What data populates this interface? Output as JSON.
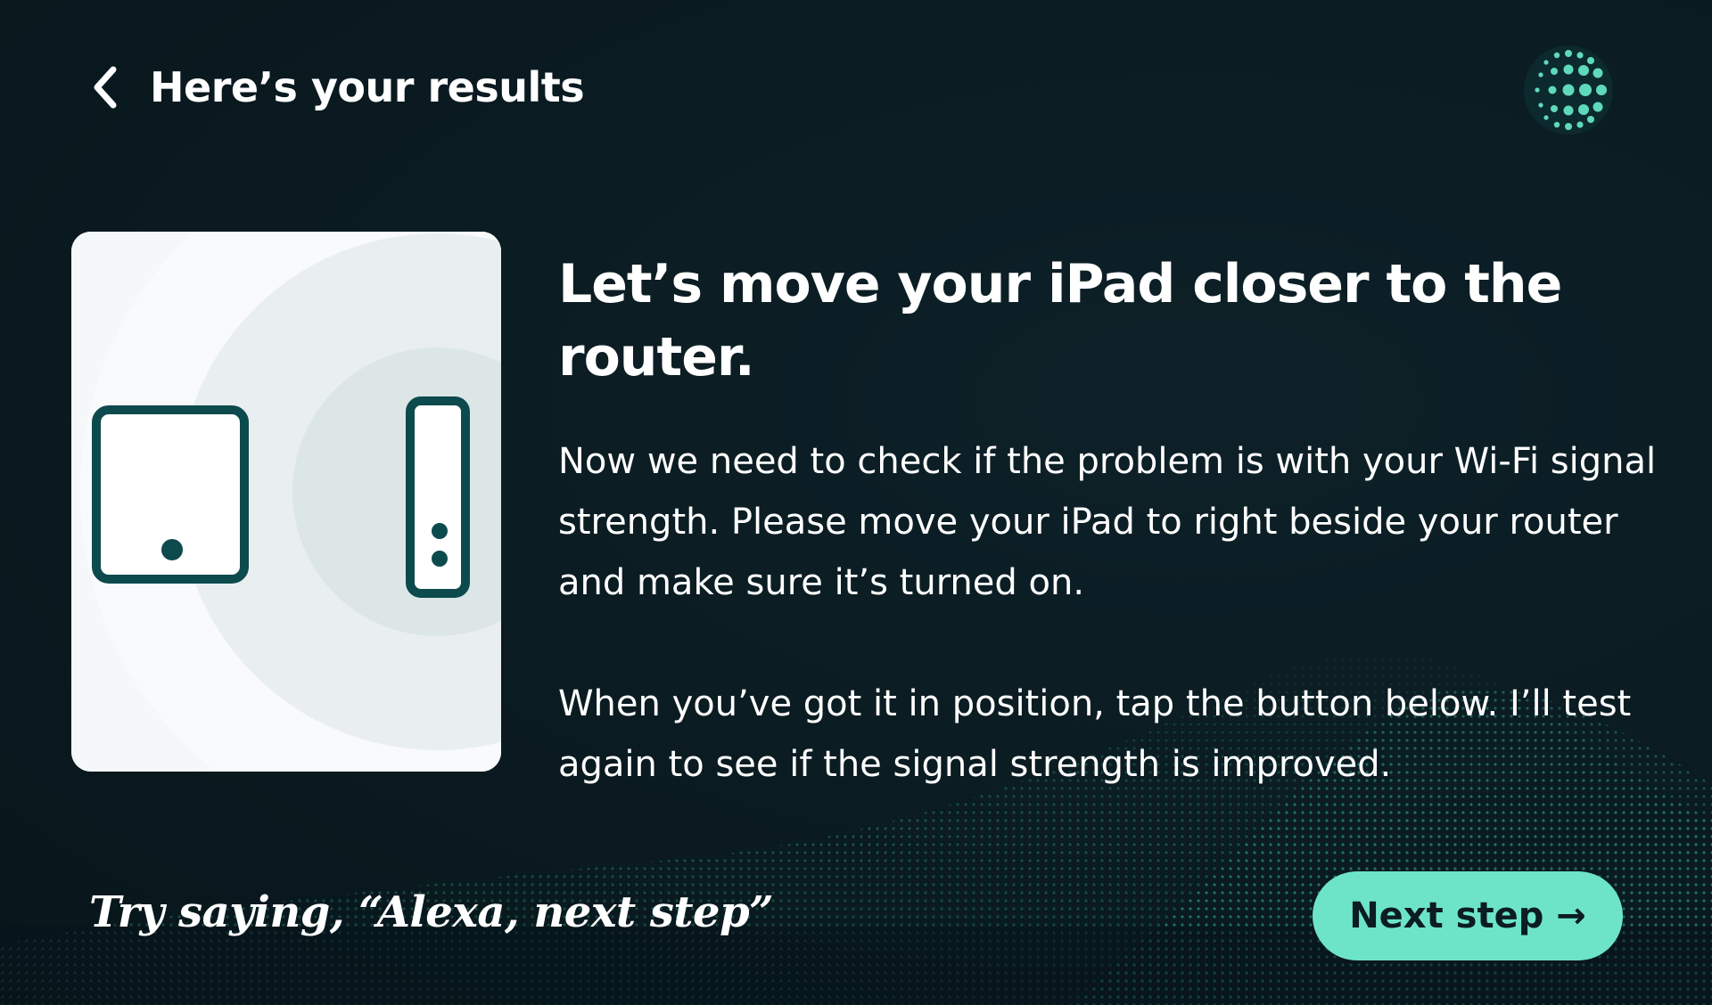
{
  "header": {
    "title": "Here’s your results",
    "back_icon": "chevron-left-icon"
  },
  "assistant": {
    "icon": "alexa-orb-icon"
  },
  "illustration": {
    "device_icon": "tablet-icon",
    "router_icon": "router-icon"
  },
  "content": {
    "headline": "Let’s move your iPad closer to the router.",
    "paragraph_1": "Now we need to check if the problem is with your Wi-Fi signal strength. Please move your iPad to right beside your router and make sure it’s turned on.",
    "paragraph_2": "When you’ve got it in position, tap the button below. I’ll test again to see if the signal strength is improved."
  },
  "footer": {
    "hint": "Try saying, “Alexa, next step”",
    "next_button_label": "Next step →"
  },
  "colors": {
    "background": "#0b1c22",
    "accent": "#6de4c8",
    "device_stroke": "#0d4a4e"
  }
}
